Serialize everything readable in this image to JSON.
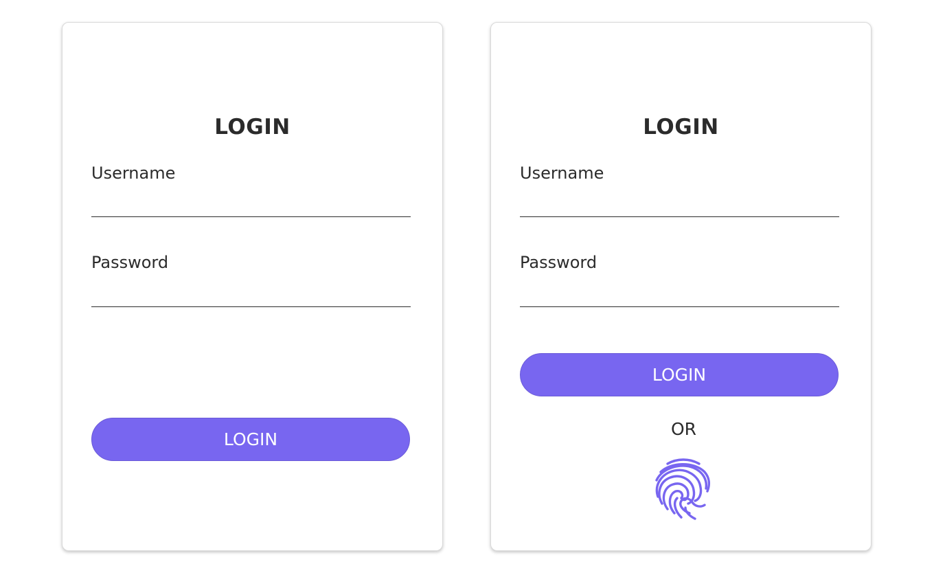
{
  "accent_color": "#7866f0",
  "forms": [
    {
      "title": "LOGIN",
      "username_label": "Username",
      "username_value": "",
      "password_label": "Password",
      "password_value": "",
      "login_button_label": "LOGIN"
    },
    {
      "title": "LOGIN",
      "username_label": "Username",
      "username_value": "",
      "password_label": "Password",
      "password_value": "",
      "login_button_label": "LOGIN",
      "alternative_separator": "OR",
      "alternative_icon": "fingerprint-icon"
    }
  ]
}
